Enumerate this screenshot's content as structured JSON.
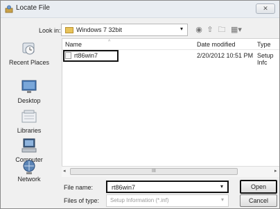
{
  "title_bar": {
    "title": "Locate File",
    "close_label": "✕",
    "app_icon": "locate-file-icon"
  },
  "look_in": {
    "label": "Look in:",
    "value": "Windows 7 32bit",
    "arrow": "▾"
  },
  "toolbar": {
    "icons": [
      "back-arrow-icon",
      "up-folder-icon",
      "new-folder-icon",
      "view-menu-icon"
    ],
    "glyphs": [
      "◉",
      "⇧",
      "🗀",
      "▦▾"
    ]
  },
  "places": [
    {
      "label": "Recent Places",
      "icon": "recent-places-icon"
    },
    {
      "label": "Desktop",
      "icon": "desktop-icon"
    },
    {
      "label": "Libraries",
      "icon": "libraries-icon"
    },
    {
      "label": "Computer",
      "icon": "computer-icon"
    },
    {
      "label": "Network",
      "icon": "network-icon"
    }
  ],
  "file_list": {
    "columns": [
      "Name",
      "Date modified",
      "Type"
    ],
    "sort_mark": "^",
    "rows": [
      {
        "name": "rt86win7",
        "date": "2/20/2012 10:51 PM",
        "type": "Setup Infc"
      }
    ],
    "scroll_left": "◂",
    "scroll_right": "▸",
    "grip": "III"
  },
  "file_name": {
    "label": "File name:",
    "value": "rt86win7",
    "arrow": "▾"
  },
  "file_type": {
    "label": "Files of type:",
    "value": "Setup Information (*.inf)",
    "arrow": "▾"
  },
  "buttons": {
    "open": "Open",
    "cancel": "Cancel"
  },
  "colors": {
    "highlight_border": "#111111",
    "window_bg": "#f0f0f0",
    "list_bg": "#ffffff"
  }
}
